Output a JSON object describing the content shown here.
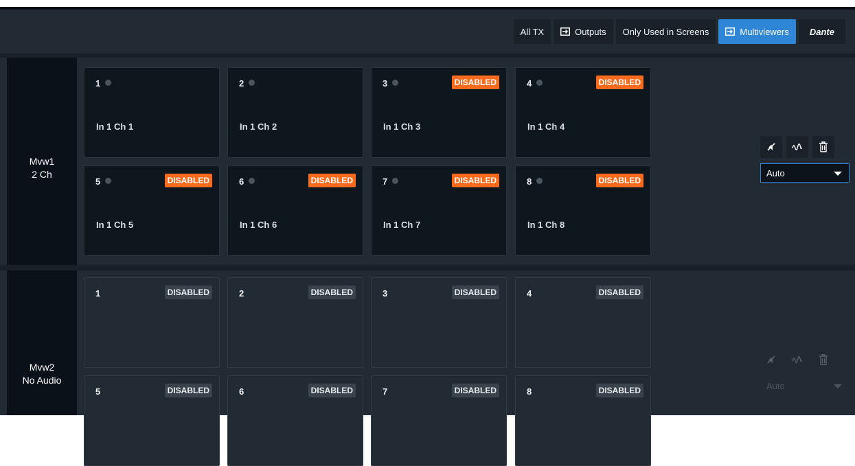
{
  "toolbar": {
    "buttons": [
      {
        "label": "All TX"
      },
      {
        "label": "Outputs"
      },
      {
        "label": "Only Used in Screens"
      },
      {
        "label": "Multiviewers",
        "active": true
      },
      {
        "label": "Dante"
      }
    ]
  },
  "multiviewers": [
    {
      "name": "Mvw1",
      "sub": "2 Ch",
      "tiles": [
        {
          "num": "1",
          "channel": "In 1 Ch 1",
          "badge": ""
        },
        {
          "num": "2",
          "channel": "In 1 Ch 2",
          "badge": ""
        },
        {
          "num": "3",
          "channel": "In 1 Ch 3",
          "badge": "DISABLED"
        },
        {
          "num": "4",
          "channel": "In 1 Ch 4",
          "badge": "DISABLED"
        },
        {
          "num": "5",
          "channel": "In 1 Ch 5",
          "badge": "DISABLED"
        },
        {
          "num": "6",
          "channel": "In 1 Ch 6",
          "badge": "DISABLED"
        },
        {
          "num": "7",
          "channel": "In 1 Ch 7",
          "badge": "DISABLED"
        },
        {
          "num": "8",
          "channel": "In 1 Ch 8",
          "badge": "DISABLED"
        }
      ],
      "select_value": "Auto"
    },
    {
      "name": "Mvw2",
      "sub": "No Audio",
      "tiles": [
        {
          "num": "1",
          "badge": "DISABLED"
        },
        {
          "num": "2",
          "badge": "DISABLED"
        },
        {
          "num": "3",
          "badge": "DISABLED"
        },
        {
          "num": "4",
          "badge": "DISABLED"
        },
        {
          "num": "5",
          "badge": "DISABLED"
        },
        {
          "num": "6",
          "badge": "DISABLED"
        },
        {
          "num": "7",
          "badge": "DISABLED"
        },
        {
          "num": "8",
          "badge": "DISABLED"
        }
      ],
      "select_value": "Auto"
    }
  ],
  "icons": [
    "mute-icon",
    "waveform-icon",
    "trash-icon",
    "output-arrow-icon"
  ],
  "colors": {
    "accent": "#2f86d6",
    "disabled_badge": "#ff6b1a",
    "tile_bg": "#0e161e",
    "panel_bg": "#222b34"
  }
}
